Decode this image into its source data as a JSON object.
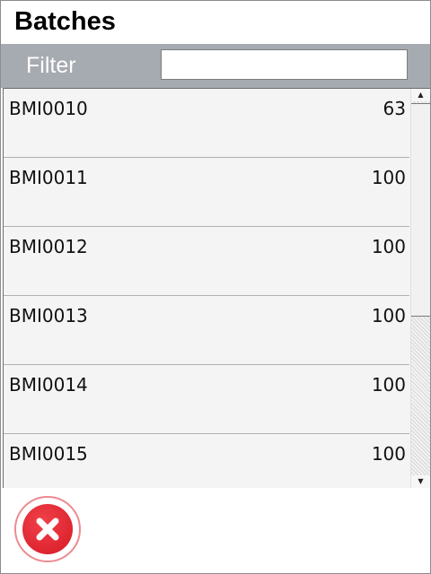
{
  "header": {
    "title": "Batches"
  },
  "filter": {
    "label": "Filter",
    "value": "",
    "placeholder": ""
  },
  "batches": [
    {
      "id": "BMI0010",
      "quantity": "63"
    },
    {
      "id": "BMI0011",
      "quantity": "100"
    },
    {
      "id": "BMI0012",
      "quantity": "100"
    },
    {
      "id": "BMI0013",
      "quantity": "100"
    },
    {
      "id": "BMI0014",
      "quantity": "100"
    },
    {
      "id": "BMI0015",
      "quantity": "100"
    }
  ],
  "icons": {
    "scroll_up": "scroll-up-arrow-icon",
    "scroll_down": "scroll-down-arrow-icon",
    "close": "close-icon"
  },
  "colors": {
    "filter_bar": "#a6aab1",
    "close_button": "#de2530",
    "list_background": "#f4f4f4"
  }
}
